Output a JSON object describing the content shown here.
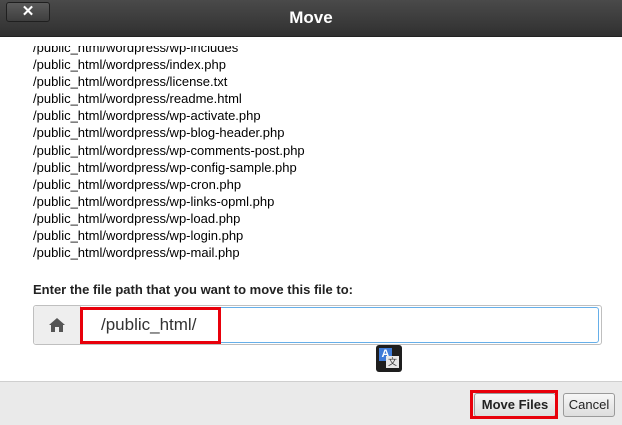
{
  "dialog": {
    "title": "Move",
    "close_label": "✕"
  },
  "files": [
    "/public_html/wordpress/wp-includes",
    "/public_html/wordpress/index.php",
    "/public_html/wordpress/license.txt",
    "/public_html/wordpress/readme.html",
    "/public_html/wordpress/wp-activate.php",
    "/public_html/wordpress/wp-blog-header.php",
    "/public_html/wordpress/wp-comments-post.php",
    "/public_html/wordpress/wp-config-sample.php",
    "/public_html/wordpress/wp-cron.php",
    "/public_html/wordpress/wp-links-opml.php",
    "/public_html/wordpress/wp-load.php",
    "/public_html/wordpress/wp-login.php",
    "/public_html/wordpress/wp-mail.php"
  ],
  "destination": {
    "prompt": "Enter the file path that you want to move this file to:",
    "value": "/public_html/",
    "home_icon": "home-icon"
  },
  "translate_icon": "translate-icon",
  "buttons": {
    "move_label": "Move Files",
    "cancel_label": "Cancel"
  },
  "colors": {
    "highlight": "#e8000b",
    "titlebar": "#3a3a3a"
  }
}
